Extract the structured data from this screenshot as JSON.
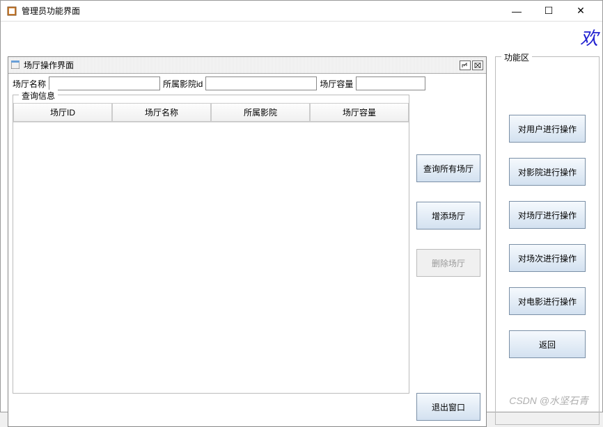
{
  "window": {
    "title": "管理员功能界面",
    "minimize": "—",
    "maximize": "☐",
    "close": "✕"
  },
  "welcome": "欢",
  "inner": {
    "title": "场厅操作界面",
    "form": {
      "label1": "场厅名称",
      "value1": "",
      "label2": "所属影院id",
      "value2": "",
      "label3": "场厅容量",
      "value3": ""
    },
    "query_legend": "查询信息",
    "columns": [
      "场厅ID",
      "场厅名称",
      "所属影院",
      "场厅容量"
    ],
    "rows": [],
    "actions": {
      "query_all": "查询所有场厅",
      "add": "增添场厅",
      "delete": "删除场厅",
      "exit": "退出窗口"
    }
  },
  "func_panel": {
    "legend": "功能区",
    "items": [
      "对用户进行操作",
      "对影院进行操作",
      "对场厅进行操作",
      "对场次进行操作",
      "对电影进行操作",
      "返回"
    ]
  },
  "watermark": "CSDN @水坚石青"
}
